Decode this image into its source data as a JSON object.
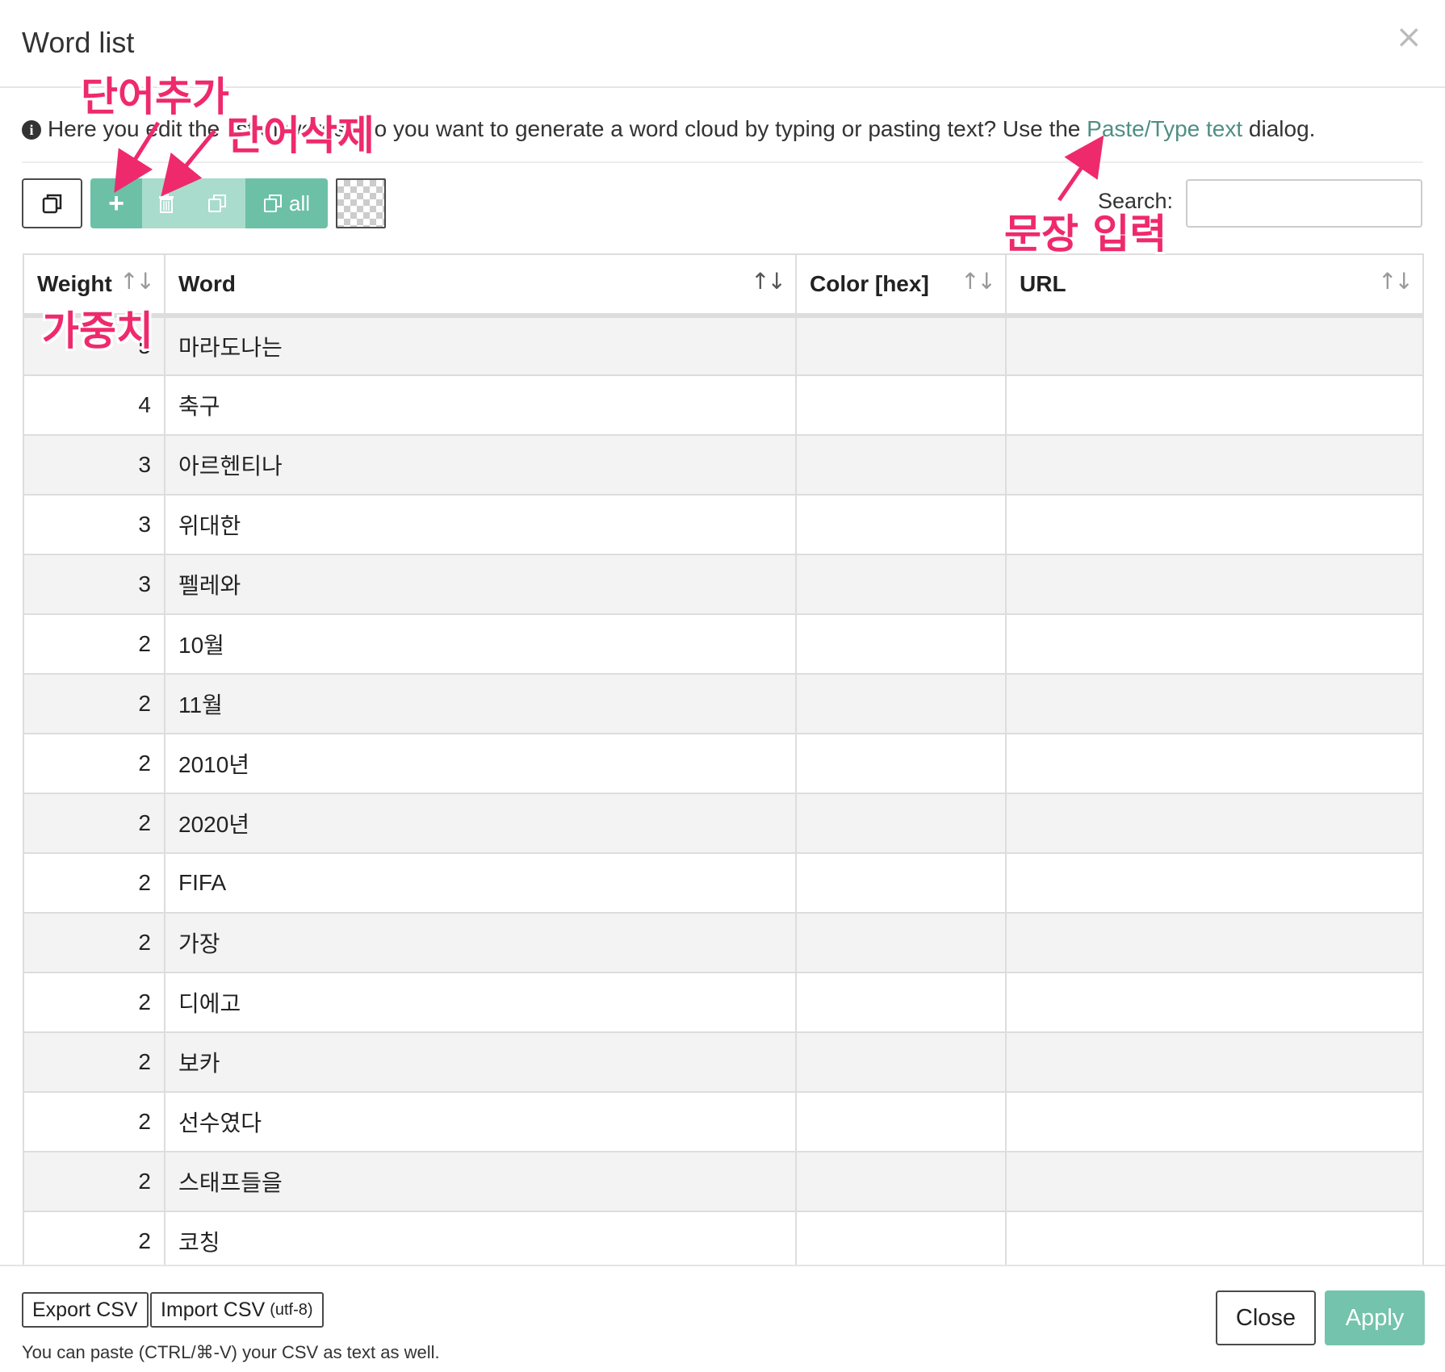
{
  "dialog": {
    "title": "Word list",
    "close_symbol": "×"
  },
  "info": {
    "text_before": "Here you edit the list of words. Do you want to generate a word cloud by typing or pasting text? Use the ",
    "link": "Paste/Type text",
    "text_after": " dialog."
  },
  "toolbar": {
    "add_symbol": "+",
    "all_label": "all"
  },
  "search": {
    "label": "Search:",
    "value": ""
  },
  "table": {
    "headers": {
      "weight": "Weight",
      "word": "Word",
      "color": "Color [hex]",
      "url": "URL"
    },
    "rows": [
      {
        "weight": "5",
        "word": "마라도나는",
        "color": "",
        "url": ""
      },
      {
        "weight": "4",
        "word": "축구",
        "color": "",
        "url": ""
      },
      {
        "weight": "3",
        "word": "아르헨티나",
        "color": "",
        "url": ""
      },
      {
        "weight": "3",
        "word": "위대한",
        "color": "",
        "url": ""
      },
      {
        "weight": "3",
        "word": "펠레와",
        "color": "",
        "url": ""
      },
      {
        "weight": "2",
        "word": "10월",
        "color": "",
        "url": ""
      },
      {
        "weight": "2",
        "word": "11월",
        "color": "",
        "url": ""
      },
      {
        "weight": "2",
        "word": "2010년",
        "color": "",
        "url": ""
      },
      {
        "weight": "2",
        "word": "2020년",
        "color": "",
        "url": ""
      },
      {
        "weight": "2",
        "word": "FIFA",
        "color": "",
        "url": ""
      },
      {
        "weight": "2",
        "word": "가장",
        "color": "",
        "url": ""
      },
      {
        "weight": "2",
        "word": "디에고",
        "color": "",
        "url": ""
      },
      {
        "weight": "2",
        "word": "보카",
        "color": "",
        "url": ""
      },
      {
        "weight": "2",
        "word": "선수였다",
        "color": "",
        "url": ""
      },
      {
        "weight": "2",
        "word": "스태프들을",
        "color": "",
        "url": ""
      },
      {
        "weight": "2",
        "word": "코칭",
        "color": "",
        "url": ""
      }
    ]
  },
  "footer": {
    "export_label": "Export CSV",
    "import_label": "Import CSV",
    "import_small": "(utf-8)",
    "note": "You can paste (CTRL/⌘-V) your CSV as text as well.",
    "close_label": "Close",
    "apply_label": "Apply"
  },
  "annotations": {
    "add_word": "단어추가",
    "delete_word": "단어삭제",
    "paste_text": "문장 입력",
    "weight": "가중치"
  },
  "colors": {
    "accent": "#6cc0a6",
    "accent_light": "#a9dccc",
    "link": "#4f8f85",
    "annotation": "#ee2a6c"
  }
}
